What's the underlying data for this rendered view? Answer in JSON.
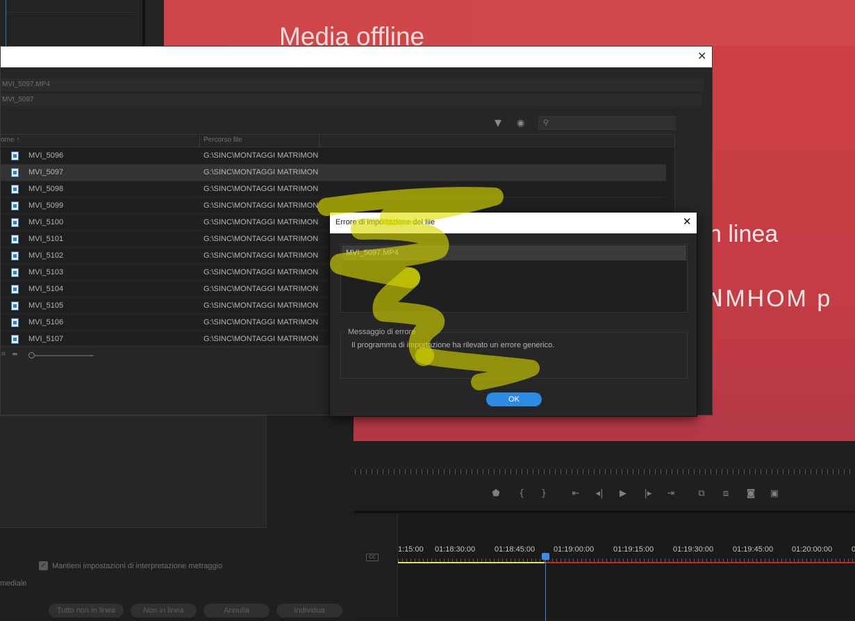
{
  "monitor": {
    "offline_title": "Media offline",
    "offline_line1": "n linea",
    "offline_line2": "ꟽMHOM p"
  },
  "link_dialog": {
    "info_file": "MVI_5097.MP4",
    "info_clip": "MVI_5097",
    "search_placeholder": "",
    "columns": {
      "name": "ome",
      "path": "Percorso file"
    },
    "rows": [
      {
        "name": "MVI_5096",
        "path": "G:\\SINC\\MONTAGGI MATRIMON"
      },
      {
        "name": "MVI_5097",
        "path": "G:\\SINC\\MONTAGGI MATRIMON"
      },
      {
        "name": "MVI_5098",
        "path": "G:\\SINC\\MONTAGGI MATRIMON"
      },
      {
        "name": "MVI_5099",
        "path": "G:\\SINC\\MONTAGGI MATRIMON"
      },
      {
        "name": "MVI_5100",
        "path": "G:\\SINC\\MONTAGGI MATRIMON"
      },
      {
        "name": "MVI_5101",
        "path": "G:\\SINC\\MONTAGGI MATRIMON"
      },
      {
        "name": "MVI_5102",
        "path": "G:\\SINC\\MONTAGGI MATRIMON"
      },
      {
        "name": "MVI_5103",
        "path": "G:\\SINC\\MONTAGGI MATRIMON"
      },
      {
        "name": "MVI_5104",
        "path": "G:\\SINC\\MONTAGGI MATRIMON"
      },
      {
        "name": "MVI_5105",
        "path": "G:\\SINC\\MONTAGGI MATRIMON"
      },
      {
        "name": "MVI_5106",
        "path": "G:\\SINC\\MONTAGGI MATRIMON"
      },
      {
        "name": "MVI_5107",
        "path": "G:\\SINC\\MONTAGGI MATRIMON"
      }
    ],
    "selected_row": 1
  },
  "error_dialog": {
    "title": "Errore di importazione del file",
    "file": "MVI_5097.MP4",
    "message_label": "Messaggio di errore",
    "message": "Il programma di importazione ha rilevato un errore generico.",
    "ok_label": "OK"
  },
  "lower_panel": {
    "checkbox_label": "Mantieni impostazioni di interpretazione metraggio",
    "checkbox_checked": true,
    "mediale_label": "mediale",
    "buttons": [
      "Tutto non in linea",
      "Non in linea",
      "Annulla",
      "Individua"
    ]
  },
  "timeline": {
    "timecodes": [
      "1:15:00",
      "01:18:30:00",
      "01:18:45:00",
      "01:19:00:00",
      "01:19:15:00",
      "01:19:30:00",
      "01:19:45:00",
      "01:20:00:00",
      "0"
    ]
  },
  "colors": {
    "accent": "#2e8be3",
    "offline_red": "#cc3f44",
    "highlighter": "#d6d600"
  }
}
